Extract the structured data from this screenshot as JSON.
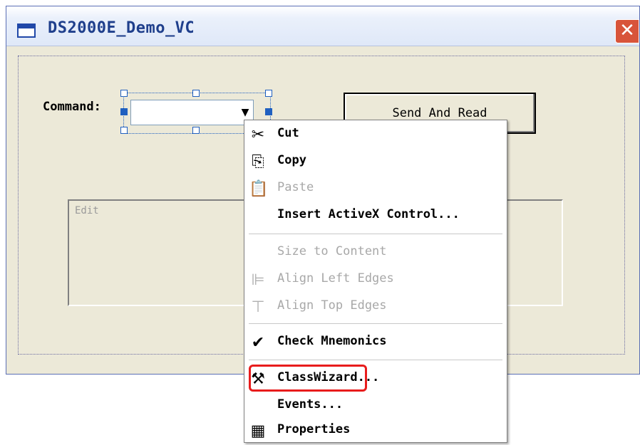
{
  "window": {
    "title": "DS2000E_Demo_VC",
    "close_glyph": "✕",
    "title_icon": "window-icon"
  },
  "dialog": {
    "command_label": "Command:",
    "send_button_label": "Send And Read",
    "edit_label": "Edit",
    "combo_arrow": "▼"
  },
  "context_menu": {
    "items": [
      {
        "label": "Cut",
        "icon": "scissors-icon",
        "glyph": "✂",
        "enabled": true
      },
      {
        "label": "Copy",
        "icon": "copy-icon",
        "glyph": "⎘",
        "enabled": true
      },
      {
        "label": "Paste",
        "icon": "paste-icon",
        "glyph": "📋",
        "enabled": false
      },
      {
        "label": "Insert ActiveX Control...",
        "icon": "",
        "glyph": "",
        "enabled": true
      },
      {
        "label": "Size to Content",
        "icon": "",
        "glyph": "",
        "enabled": false
      },
      {
        "label": "Align Left Edges",
        "icon": "align-left-icon",
        "glyph": "⊫",
        "enabled": false
      },
      {
        "label": "Align Top Edges",
        "icon": "align-top-icon",
        "glyph": "⊤",
        "enabled": false
      },
      {
        "label": "Check Mnemonics",
        "icon": "check-icon",
        "glyph": "✔",
        "enabled": true
      },
      {
        "label": "ClassWizard...",
        "icon": "wand-icon",
        "glyph": "⚒",
        "enabled": true
      },
      {
        "label": "Events...",
        "icon": "",
        "glyph": "",
        "enabled": true
      },
      {
        "label": "Properties",
        "icon": "properties-icon",
        "glyph": "▦",
        "enabled": true
      }
    ]
  },
  "colors": {
    "highlight_border": "#e81c1c",
    "title_text": "#1f3f8c",
    "close_button": "#d8543a"
  }
}
